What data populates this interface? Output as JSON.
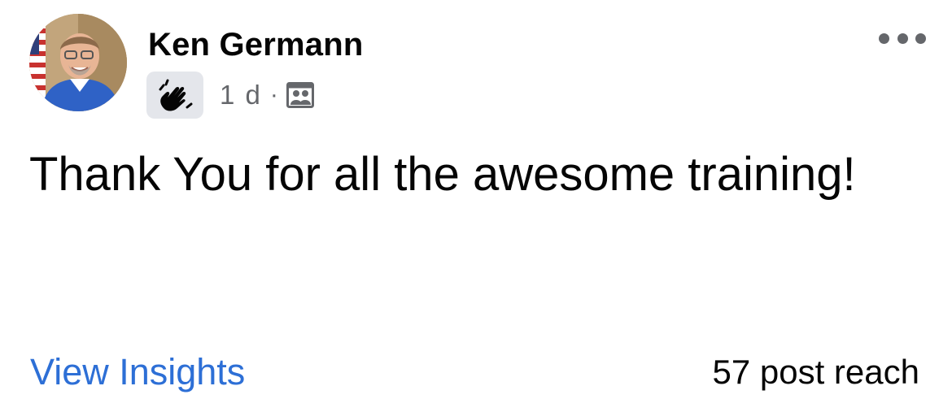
{
  "post": {
    "author_name": "Ken Germann",
    "timestamp": "1 d",
    "separator": "·",
    "badge_icon": "wave-hand-icon",
    "audience_icon": "group-audience-icon",
    "more_icon": "more-options-icon",
    "text": "Thank You for all the awesome training!"
  },
  "footer": {
    "insights_label": "View Insights",
    "reach_text": "57 post reach"
  },
  "colors": {
    "link": "#2d6fd6",
    "secondary_text": "#65676b",
    "primary_text": "#050505",
    "badge_bg": "#e4e6eb"
  }
}
